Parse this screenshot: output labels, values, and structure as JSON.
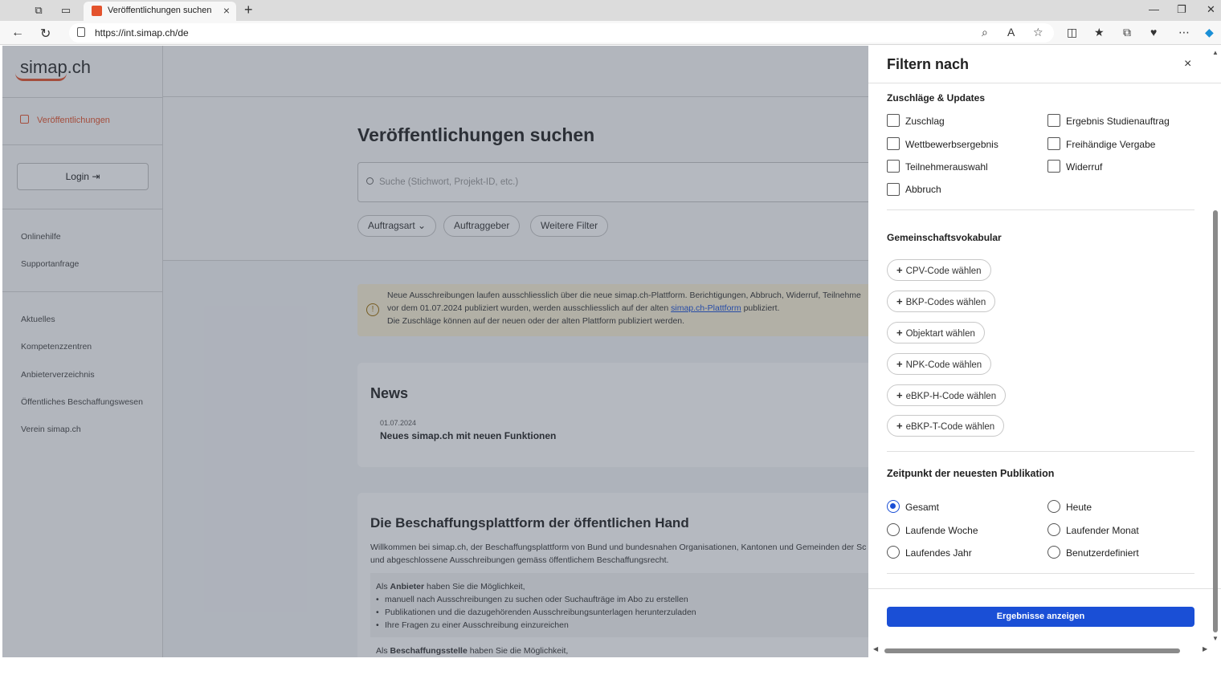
{
  "browser": {
    "tab_title": "Veröffentlichungen suchen",
    "url": "https://int.simap.ch/de",
    "new_tab": "+",
    "tab_close": "×"
  },
  "sidebar": {
    "logo": "simap.ch",
    "active_item": "Veröffentlichungen",
    "login": "Login",
    "help_links": [
      "Onlinehilfe",
      "Supportanfrage"
    ],
    "links": [
      "Aktuelles",
      "Kompetenzzentren",
      "Anbieterverzeichnis",
      "Öffentliches Beschaffungswesen",
      "Verein simap.ch"
    ]
  },
  "main": {
    "title": "Veröffentlichungen suchen",
    "search_placeholder": "Suche (Stichwort, Projekt-ID, etc.)",
    "filters": [
      "Auftragsart",
      "Auftraggeber",
      "Weitere Filter"
    ],
    "notice": {
      "line1": "Neue Ausschreibungen laufen ausschliesslich über die neue simap.ch-Plattform. Berichtigungen, Abbruch, Widerruf, Teilnehme",
      "line2_pre": "vor dem 01.07.2024 publiziert wurden, werden ausschliesslich auf der alten ",
      "line2_link": "simap.ch-Plattform",
      "line2_post": " publiziert.",
      "line3": "Die Zuschläge können auf der neuen oder der alten Plattform publiziert werden."
    },
    "news": {
      "title": "News",
      "date": "01.07.2024",
      "headline": "Neues simap.ch mit neuen Funktionen"
    },
    "platform": {
      "title": "Die Beschaffungsplattform der öffentlichen Hand",
      "intro1": "Willkommen bei simap.ch, der Beschaffungsplattform von Bund und bundesnahen Organisationen, Kantonen und Gemeinden der Sc",
      "intro2": "und abgeschlossene Ausschreibungen gemäss öffentlichem Beschaffungsrecht.",
      "bidder_pre": "Als ",
      "bidder_bold": "Anbieter",
      "bidder_post": " haben Sie die Möglichkeit,",
      "bullets": [
        "manuell nach Ausschreibungen zu suchen oder Suchaufträge im Abo zu erstellen",
        "Publikationen und die dazugehörenden Ausschreibungsunterlagen herunterzuladen",
        "Ihre Fragen zu einer Ausschreibung einzureichen"
      ],
      "office_pre": "Als ",
      "office_bold": "Beschaffungsstelle",
      "office_post": " haben Sie die Möglichkeit,"
    }
  },
  "panel": {
    "title": "Filtern nach",
    "close": "×",
    "section1": {
      "title": "Zuschläge & Updates",
      "options": [
        "Zuschlag",
        "Ergebnis Studienauftrag",
        "Wettbewerbsergebnis",
        "Freihändige Vergabe",
        "Teilnehmerauswahl",
        "Widerruf",
        "Abbruch"
      ]
    },
    "section2": {
      "title": "Gemeinschaftsvokabular",
      "buttons": [
        "CPV-Code wählen",
        "BKP-Codes wählen",
        "Objektart wählen",
        "NPK-Code wählen",
        "eBKP-H-Code wählen",
        "eBKP-T-Code wählen"
      ]
    },
    "section3": {
      "title": "Zeitpunkt der neuesten Publikation",
      "options": [
        "Gesamt",
        "Heute",
        "Laufende Woche",
        "Laufender Monat",
        "Laufendes Jahr",
        "Benutzerdefiniert"
      ],
      "selected": "Gesamt"
    },
    "apply": "Ergebnisse anzeigen"
  },
  "colors": {
    "brand": "#e4532d",
    "primary": "#1a4fd6",
    "notice_bg": "#fbf1d6"
  }
}
